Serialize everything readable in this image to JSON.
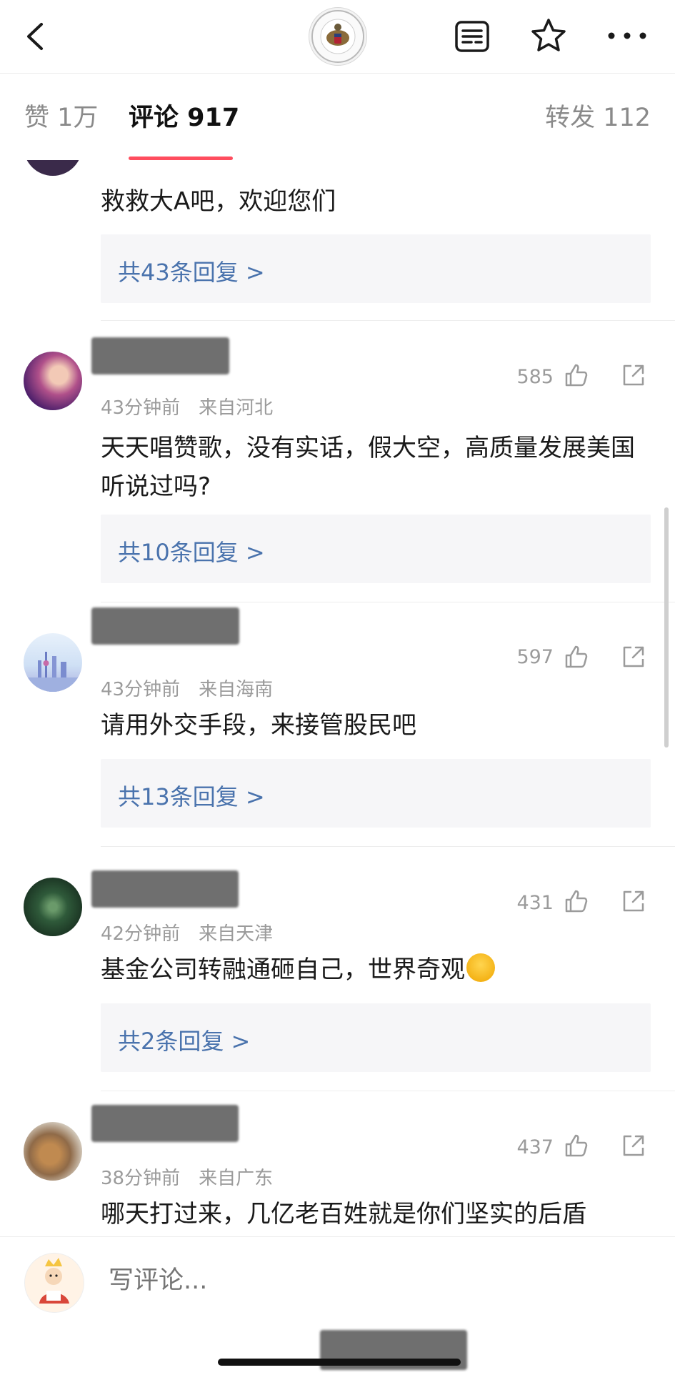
{
  "nav": {
    "back_icon": "chevron-left-icon",
    "avatar_icon": "embassy-seal",
    "reader_icon": "reader-icon",
    "favorite_icon": "star-icon",
    "more_icon": "more-icon"
  },
  "tabs": {
    "likes": "赞 1万",
    "comments": "评论 917",
    "reposts": "转发 112",
    "active": "comments",
    "accent": "#ff4d5e"
  },
  "comments": [
    {
      "text": "救救大A吧，欢迎您们",
      "replies": "共43条回复 >"
    },
    {
      "likes": "585",
      "time": "43分钟前",
      "location": "来自河北",
      "text": "天天唱赞歌，没有实话，假大空，高质量发展美国听说过吗?",
      "replies": "共10条回复 >"
    },
    {
      "likes": "597",
      "time": "43分钟前",
      "location": "来自海南",
      "text": "请用外交手段，来接管股民吧",
      "replies": "共13条回复 >"
    },
    {
      "likes": "431",
      "time": "42分钟前",
      "location": "来自天津",
      "text": "基金公司转融通砸自己，世界奇观",
      "replies": "共2条回复 >"
    },
    {
      "likes": "437",
      "time": "38分钟前",
      "location": "来自广东",
      "text": "哪天打过来，几亿老百姓就是你们坚实的后盾"
    }
  ],
  "composer": {
    "placeholder": "写评论..."
  },
  "colors": {
    "link": "#4a73ad",
    "meta": "#9b9b9b",
    "reply_bg": "#f6f6f8"
  }
}
